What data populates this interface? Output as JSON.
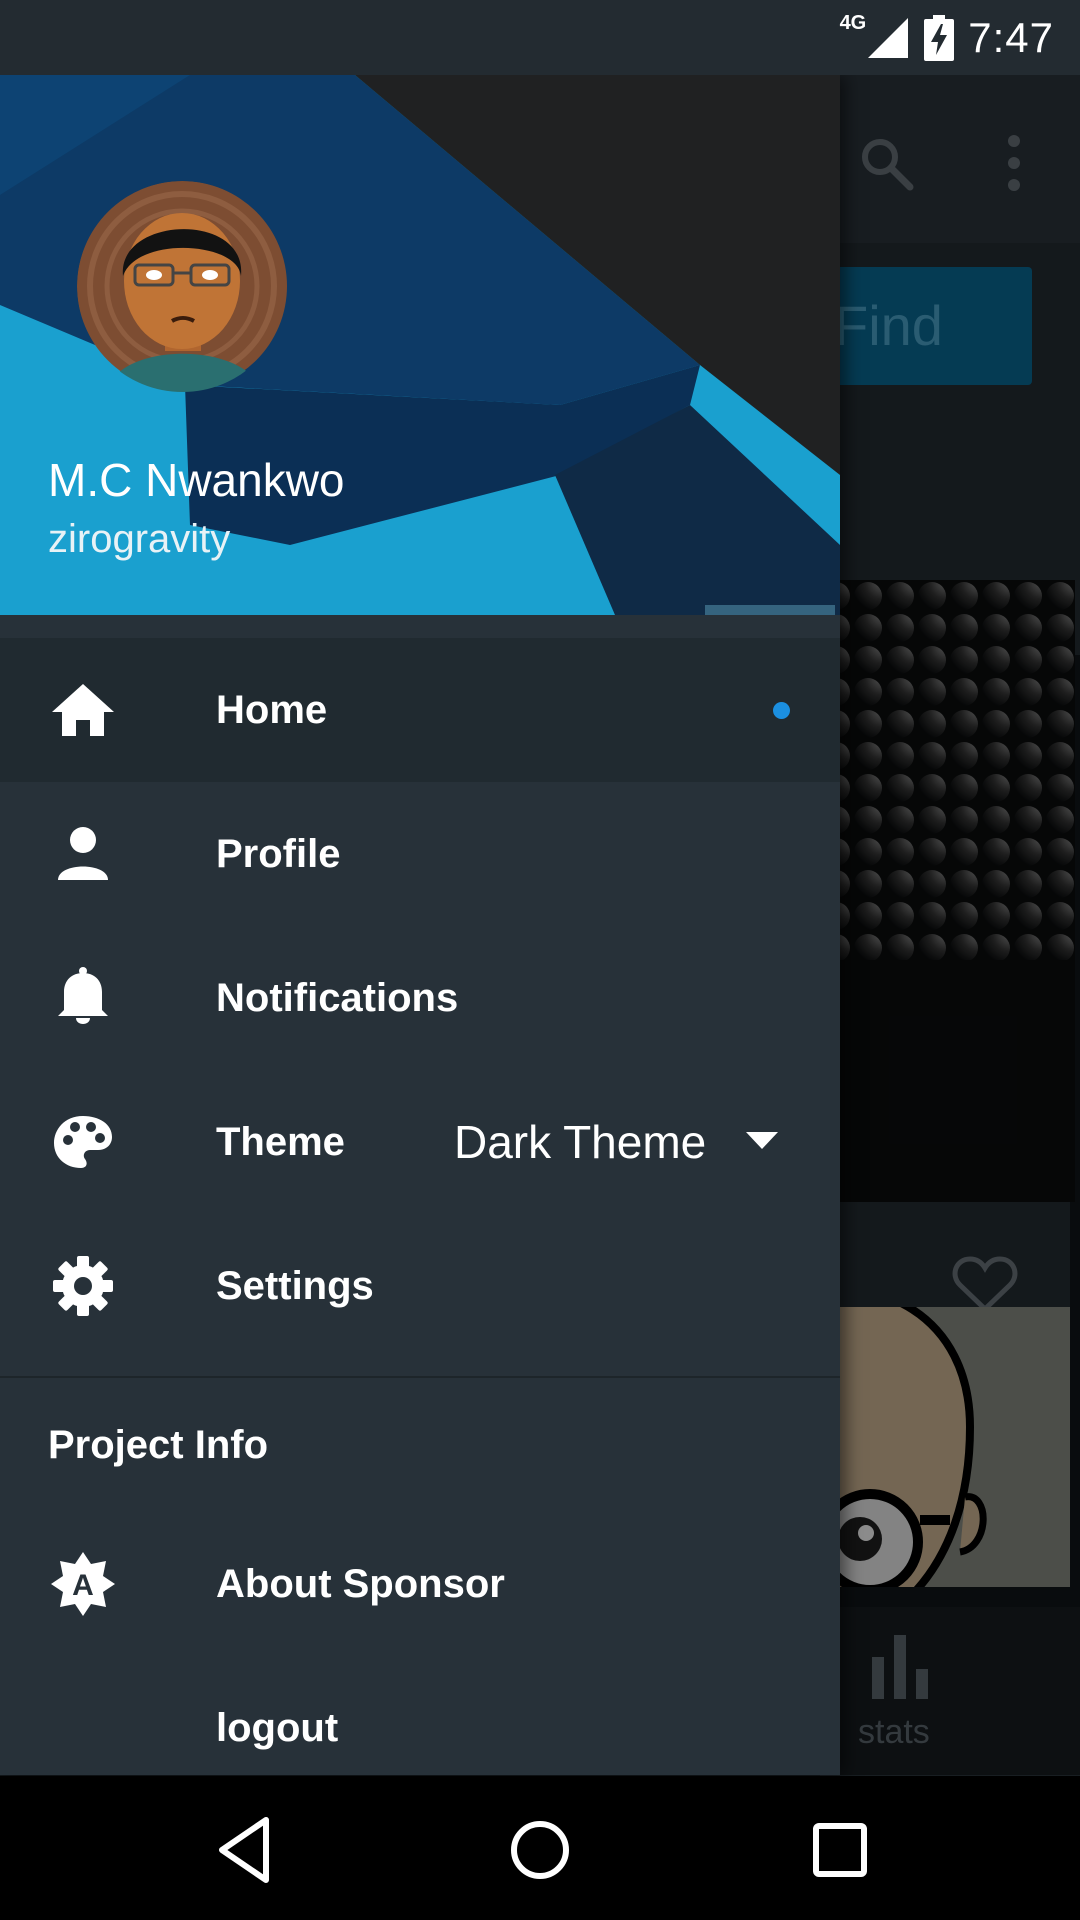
{
  "status_bar": {
    "network": "4G",
    "time": "7:47",
    "icons": [
      "signal-icon",
      "battery-charging-icon"
    ]
  },
  "background_app": {
    "find_button_label": "Find",
    "tab_label": "stats",
    "icons": [
      "search-icon",
      "more-vert-icon",
      "heart-outline-icon",
      "bar-chart-icon"
    ]
  },
  "drawer": {
    "header": {
      "name": "M.C Nwankwo",
      "handle": "zirogravity"
    },
    "items": [
      {
        "label": "Home",
        "icon": "home-icon",
        "active": true
      },
      {
        "label": "Profile",
        "icon": "person-icon"
      },
      {
        "label": "Notifications",
        "icon": "bell-icon"
      },
      {
        "label": "Theme",
        "icon": "palette-icon",
        "value": "Dark Theme"
      },
      {
        "label": "Settings",
        "icon": "gear-icon"
      }
    ],
    "section_title": "Project Info",
    "section_items": [
      {
        "label": "About Sponsor",
        "icon": "sponsor-badge-icon"
      },
      {
        "label": "logout"
      }
    ]
  },
  "colors": {
    "drawer_bg": "#273139",
    "accent": "#1b8fe0",
    "active_row": "#202a30"
  }
}
